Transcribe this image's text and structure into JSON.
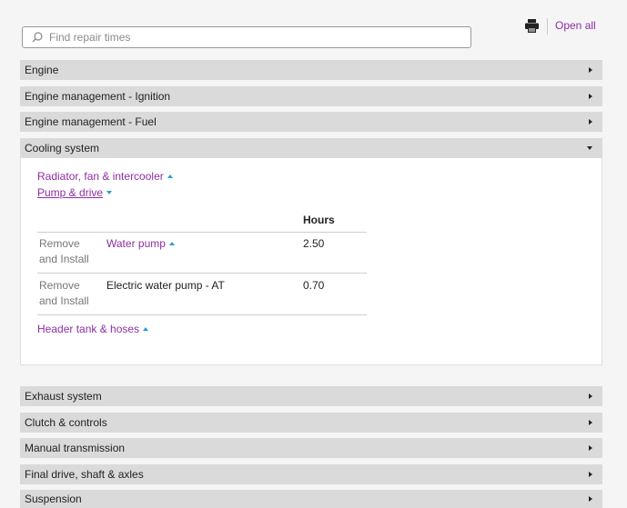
{
  "search": {
    "placeholder": "Find repair times",
    "value": ""
  },
  "toolbar": {
    "open_all": "Open all"
  },
  "sections_top": [
    {
      "label": "Engine"
    },
    {
      "label": "Engine management - Ignition"
    },
    {
      "label": "Engine management - Fuel"
    }
  ],
  "expanded": {
    "label": "Cooling system",
    "subgroups": [
      {
        "label": "Radiator, fan & intercooler"
      },
      {
        "label": "Pump & drive"
      },
      {
        "label": "Header tank & hoses"
      }
    ],
    "table": {
      "hours_header": "Hours",
      "rows": [
        {
          "operation": "Remove and Install",
          "part": "Water pump",
          "hours": "2.50"
        },
        {
          "operation": "Remove and Install",
          "part": "Electric water pump - AT",
          "hours": "0.70"
        }
      ]
    }
  },
  "sections_bottom": [
    {
      "label": "Exhaust system"
    },
    {
      "label": "Clutch & controls"
    },
    {
      "label": "Manual transmission"
    },
    {
      "label": "Final drive, shaft & axles"
    },
    {
      "label": "Suspension"
    }
  ]
}
